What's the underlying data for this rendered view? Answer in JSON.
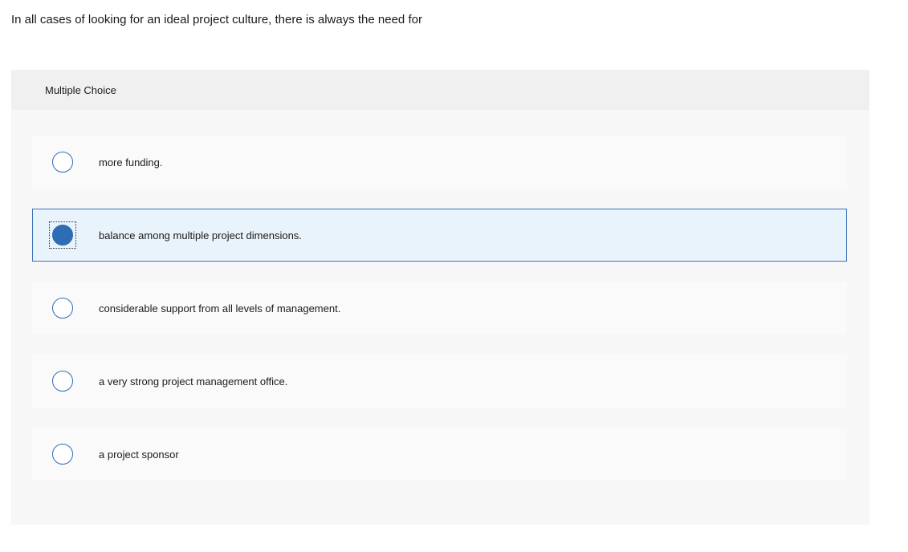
{
  "question": {
    "text": "In all cases of looking for an ideal project culture, there is always the need for"
  },
  "panel": {
    "header": "Multiple Choice"
  },
  "options": [
    {
      "label": "more funding.",
      "selected": false
    },
    {
      "label": "balance among multiple project dimensions.",
      "selected": true
    },
    {
      "label": "considerable support from all levels of management.",
      "selected": false
    },
    {
      "label": "a very strong project management office.",
      "selected": false
    },
    {
      "label": "a project sponsor",
      "selected": false
    }
  ],
  "colors": {
    "accent": "#2e6db5",
    "selected_background": "#e8f3fc",
    "panel_background": "#f7f7f7",
    "header_background": "#f0f0f0"
  }
}
